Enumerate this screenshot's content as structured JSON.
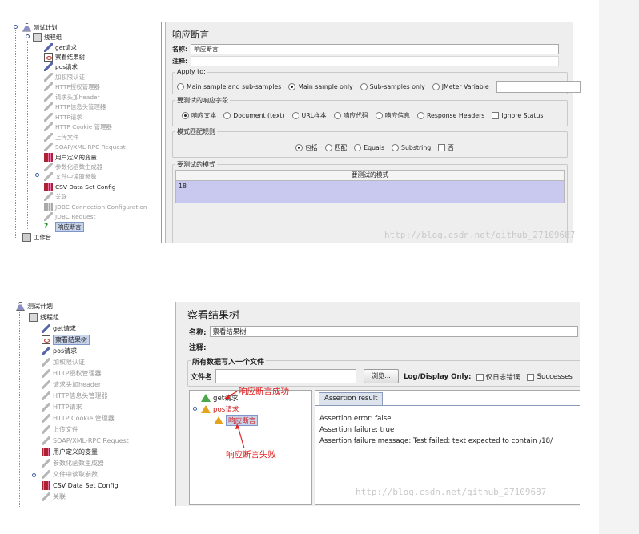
{
  "tree1": {
    "items": [
      {
        "label": "测试计划",
        "icon": "test-plan-icon"
      },
      {
        "label": "线程组",
        "icon": "thread-group-icon"
      },
      {
        "label": "get请求",
        "icon": "sampler-icon"
      },
      {
        "label": "察看结果树",
        "icon": "view-results-icon"
      },
      {
        "label": "pos请求",
        "icon": "sampler-icon"
      },
      {
        "label": "加权限认证",
        "icon": "config-icon"
      },
      {
        "label": "HTTP授权管理器",
        "icon": "config-icon"
      },
      {
        "label": "请求头加header",
        "icon": "config-icon"
      },
      {
        "label": "HTTP信息头管理器",
        "icon": "config-icon"
      },
      {
        "label": "HTTP请求",
        "icon": "config-icon"
      },
      {
        "label": "HTTP Cookie 管理器",
        "icon": "config-icon"
      },
      {
        "label": "上传文件",
        "icon": "config-icon"
      },
      {
        "label": "SOAP/XML-RPC Request",
        "icon": "config-icon"
      },
      {
        "label": "用户定义的变量",
        "icon": "variables-icon"
      },
      {
        "label": "参数化函数生成器",
        "icon": "config-icon"
      },
      {
        "label": "文件中读取参数",
        "icon": "config-icon"
      },
      {
        "label": "CSV Data Set Config",
        "icon": "csv-icon"
      },
      {
        "label": "关联",
        "icon": "config-icon"
      },
      {
        "label": "JDBC Connection Configuration",
        "icon": "config-icon"
      },
      {
        "label": "JDBC Request",
        "icon": "config-icon"
      },
      {
        "label": "响应断言",
        "icon": "assertion-icon"
      },
      {
        "label": "工作台",
        "icon": "workbench-icon"
      }
    ]
  },
  "assertion_panel": {
    "title": "响应断言",
    "name_label": "名称:",
    "name_value": "响应断言",
    "comment_label": "注释:",
    "comment_value": "",
    "apply_to": {
      "label": "Apply to:",
      "options": [
        "Main sample and sub-samples",
        "Main sample only",
        "Sub-samples only",
        "JMeter Variable"
      ],
      "selected": "Main sample only",
      "variable_value": ""
    },
    "field_to_test": {
      "label": "要测试的响应字段",
      "options": [
        "响应文本",
        "Document (text)",
        "URL样本",
        "响应代码",
        "响应信息",
        "Response Headers"
      ],
      "selected": "响应文本",
      "ignore_status_label": "Ignore Status"
    },
    "pattern_matching": {
      "label": "模式匹配规则",
      "options": [
        "包括",
        "匹配",
        "Equals",
        "Substring"
      ],
      "selected": "包括",
      "not_label": "否"
    },
    "patterns": {
      "label": "要测试的模式",
      "column": "要测试的模式",
      "rows": [
        "18"
      ]
    },
    "watermark": "http://blog.csdn.net/github_27109687"
  },
  "tree2": {
    "items": [
      {
        "label": "测试计划"
      },
      {
        "label": "线程组"
      },
      {
        "label": "get请求"
      },
      {
        "label": "察看结果树"
      },
      {
        "label": "pos请求"
      },
      {
        "label": "加权限认证"
      },
      {
        "label": "HTTP授权管理器"
      },
      {
        "label": "请求头加header"
      },
      {
        "label": "HTTP信息头管理器"
      },
      {
        "label": "HTTP请求"
      },
      {
        "label": "HTTP Cookie 管理器"
      },
      {
        "label": "上传文件"
      },
      {
        "label": "SOAP/XML-RPC Request"
      },
      {
        "label": "用户定义的变量"
      },
      {
        "label": "参数化函数生成器"
      },
      {
        "label": "文件中读取参数"
      },
      {
        "label": "CSV Data Set Config"
      },
      {
        "label": "关联"
      }
    ]
  },
  "results_panel": {
    "title": "察看结果树",
    "name_label": "名称:",
    "name_value": "察看结果树",
    "comment_label": "注释:",
    "section_label": "所有数据写入一个文件",
    "file_label": "文件名",
    "file_value": "",
    "browse_label": "浏览...",
    "log_display_label": "Log/Display Only:",
    "errors_only_label": "仅日志错误",
    "successes_label": "Successes",
    "results_tree": [
      {
        "label": "get请求",
        "status": "success"
      },
      {
        "label": "pos请求",
        "status": "failure"
      },
      {
        "label": "响应断言",
        "status": "failure"
      }
    ],
    "tab_label": "Assertion result",
    "assertion_lines": [
      "Assertion error: false",
      "Assertion failure: true",
      "Assertion failure message: Test failed: text expected to contain /18/"
    ],
    "annotation_success": "响应断言成功",
    "annotation_fail": "响应断言失败",
    "watermark": "http://blog.csdn.net/github_27109687"
  }
}
